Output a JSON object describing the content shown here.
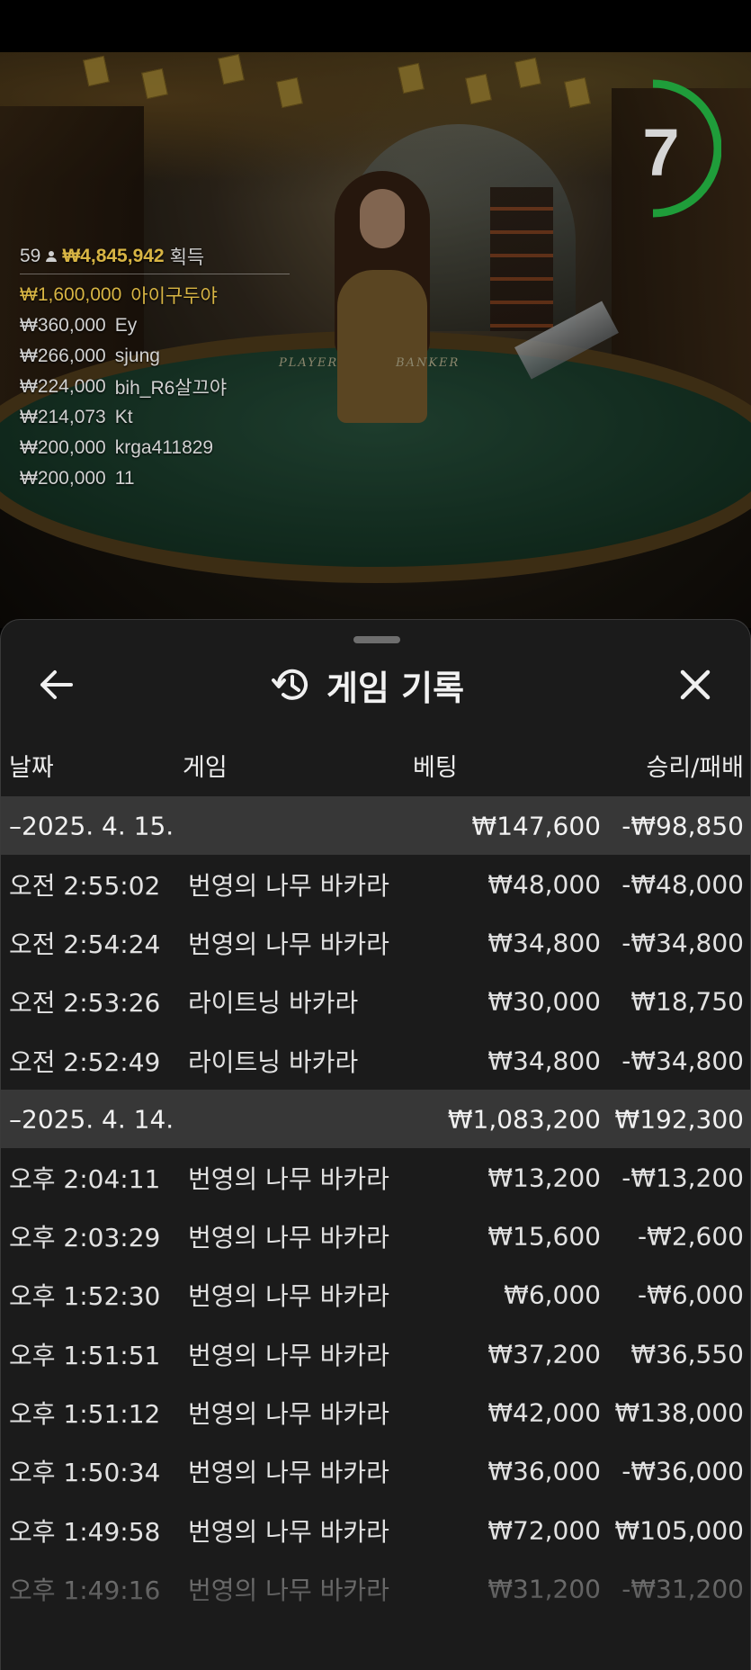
{
  "game": {
    "timer": "7",
    "table_labels": [
      "PLAYER",
      "BANKER"
    ],
    "winners": {
      "count": "59",
      "total": "₩4,845,942",
      "suffix": "획득",
      "rows": [
        {
          "amount": "₩1,600,000",
          "name": "아이구두야"
        },
        {
          "amount": "₩360,000",
          "name": "Ey"
        },
        {
          "amount": "₩266,000",
          "name": "sjung"
        },
        {
          "amount": "₩224,000",
          "name": "bih_R6살끄야"
        },
        {
          "amount": "₩214,073",
          "name": "Kt"
        },
        {
          "amount": "₩200,000",
          "name": "krga411829"
        },
        {
          "amount": "₩200,000",
          "name": "11"
        }
      ]
    }
  },
  "history": {
    "title": "게임 기록",
    "columns": {
      "date": "날짜",
      "game": "게임",
      "bet": "베팅",
      "result": "승리/패배"
    },
    "groups": [
      {
        "date": "–2025. 4. 15.",
        "bet": "₩147,600",
        "result": "-₩98,850",
        "items": [
          {
            "time": "오전 2:55:02",
            "game": "번영의 나무 바카라",
            "bet": "₩48,000",
            "result": "-₩48,000"
          },
          {
            "time": "오전 2:54:24",
            "game": "번영의 나무 바카라",
            "bet": "₩34,800",
            "result": "-₩34,800"
          },
          {
            "time": "오전 2:53:26",
            "game": "라이트닝 바카라",
            "bet": "₩30,000",
            "result": "₩18,750"
          },
          {
            "time": "오전 2:52:49",
            "game": "라이트닝 바카라",
            "bet": "₩34,800",
            "result": "-₩34,800"
          }
        ]
      },
      {
        "date": "–2025. 4. 14.",
        "bet": "₩1,083,200",
        "result": "₩192,300",
        "items": [
          {
            "time": "오후 2:04:11",
            "game": "번영의 나무 바카라",
            "bet": "₩13,200",
            "result": "-₩13,200"
          },
          {
            "time": "오후 2:03:29",
            "game": "번영의 나무 바카라",
            "bet": "₩15,600",
            "result": "-₩2,600"
          },
          {
            "time": "오후 1:52:30",
            "game": "번영의 나무 바카라",
            "bet": "₩6,000",
            "result": "-₩6,000"
          },
          {
            "time": "오후 1:51:51",
            "game": "번영의 나무 바카라",
            "bet": "₩37,200",
            "result": "₩36,550"
          },
          {
            "time": "오후 1:51:12",
            "game": "번영의 나무 바카라",
            "bet": "₩42,000",
            "result": "₩138,000"
          },
          {
            "time": "오후 1:50:34",
            "game": "번영의 나무 바카라",
            "bet": "₩36,000",
            "result": "-₩36,000"
          },
          {
            "time": "오후 1:49:58",
            "game": "번영의 나무 바카라",
            "bet": "₩72,000",
            "result": "₩105,000"
          },
          {
            "time": "오후 1:49:16",
            "game": "번영의 나무 바카라",
            "bet": "₩31,200",
            "result": "-₩31,200"
          }
        ]
      }
    ]
  },
  "icons": {
    "back": "arrow-left-icon",
    "history": "history-icon",
    "close": "close-icon",
    "users": "users-icon"
  },
  "colors": {
    "sheet_bg": "#1b1b1b",
    "group_bg": "#373737",
    "gold": "#d8b544",
    "timer_green": "#1f9d3a"
  }
}
